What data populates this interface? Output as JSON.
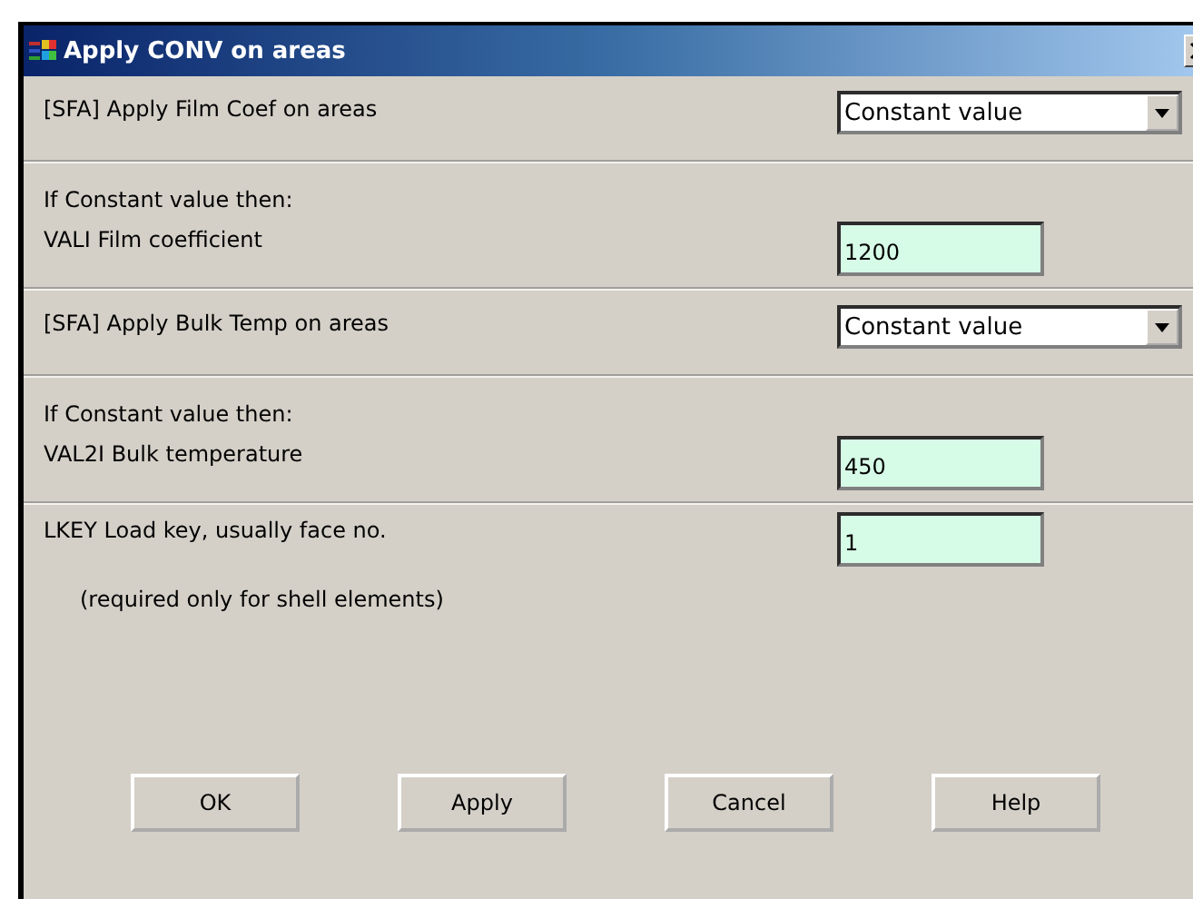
{
  "window": {
    "title": "Apply CONV on areas"
  },
  "sections": [
    {
      "rows": [
        {
          "kind": "select",
          "label": "[SFA] Apply Film Coef on areas",
          "value": "Constant value"
        }
      ]
    },
    {
      "rows": [
        {
          "kind": "note",
          "label": "If Constant value then:"
        },
        {
          "kind": "input",
          "label": "VALI  Film coefficient",
          "value": "1200"
        }
      ]
    },
    {
      "rows": [
        {
          "kind": "select",
          "label": "[SFA] Apply Bulk Temp on areas",
          "value": "Constant value"
        }
      ]
    },
    {
      "rows": [
        {
          "kind": "note",
          "label": "If Constant value then:"
        },
        {
          "kind": "input",
          "label": "VAL2I  Bulk temperature",
          "value": "450"
        }
      ]
    },
    {
      "rows": [
        {
          "kind": "input",
          "label": "LKEY  Load key, usually face no.",
          "value": "1"
        },
        {
          "kind": "hint",
          "label": "(required only for shell elements)"
        }
      ]
    }
  ],
  "buttons": [
    "OK",
    "Apply",
    "Cancel",
    "Help"
  ]
}
